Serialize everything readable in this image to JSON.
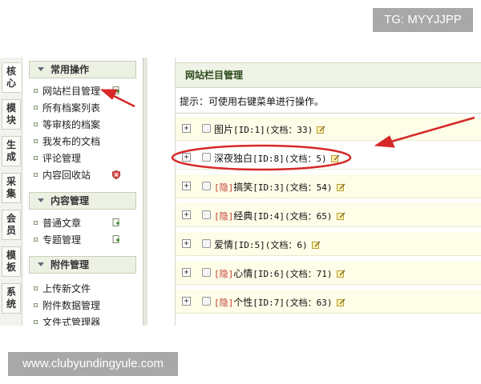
{
  "watermarks": {
    "top": "TG: MYYJJPP",
    "bottom": "www.clubyundingyule.com"
  },
  "vertical_tabs": [
    {
      "label": "核心",
      "active": true
    },
    {
      "label": "模块",
      "active": false
    },
    {
      "label": "生成",
      "active": false
    },
    {
      "label": "采集",
      "active": false
    },
    {
      "label": "会员",
      "active": false
    },
    {
      "label": "模板",
      "active": false
    },
    {
      "label": "系统",
      "active": false
    }
  ],
  "menu_groups": [
    {
      "title": "常用操作",
      "items": [
        "网站栏目管理",
        "所有档案列表",
        "等审核的档案",
        "我发布的文档",
        "评论管理",
        "内容回收站"
      ]
    },
    {
      "title": "内容管理",
      "items": [
        "普通文章",
        "专题管理"
      ]
    },
    {
      "title": "附件管理",
      "items": [
        "上传新文件",
        "附件数据管理",
        "文件式管理器"
      ]
    }
  ],
  "main": {
    "header_title": "网站栏目管理",
    "hint": "提示：可使用右键菜单进行操作。",
    "rows": [
      {
        "hidden_tag": "",
        "name": "图片",
        "meta": "[ID:1](文档：33)"
      },
      {
        "hidden_tag": "",
        "name": "深夜独白",
        "meta": "[ID:8](文档：5)"
      },
      {
        "hidden_tag": "[隐]",
        "name": "搞笑",
        "meta": "[ID:3](文档：54)"
      },
      {
        "hidden_tag": "[隐]",
        "name": "经典",
        "meta": "[ID:4](文档：65)"
      },
      {
        "hidden_tag": "",
        "name": "爱情",
        "meta": "[ID:5](文档：6)"
      },
      {
        "hidden_tag": "[隐]",
        "name": "心情",
        "meta": "[ID:6](文档：71)"
      },
      {
        "hidden_tag": "[隐]",
        "name": "个性",
        "meta": "[ID:7](文档：63)"
      }
    ],
    "expand_glyph": "+"
  },
  "icons": {
    "menu_item_action": "add-page-icon",
    "recycle_bin_action": "shield-delete-icon",
    "row_action": "edit-note-icon"
  },
  "colors": {
    "annotation_red": "#d62828",
    "hidden_tag": "#c0392b",
    "header_green": "#2c4a1c"
  }
}
